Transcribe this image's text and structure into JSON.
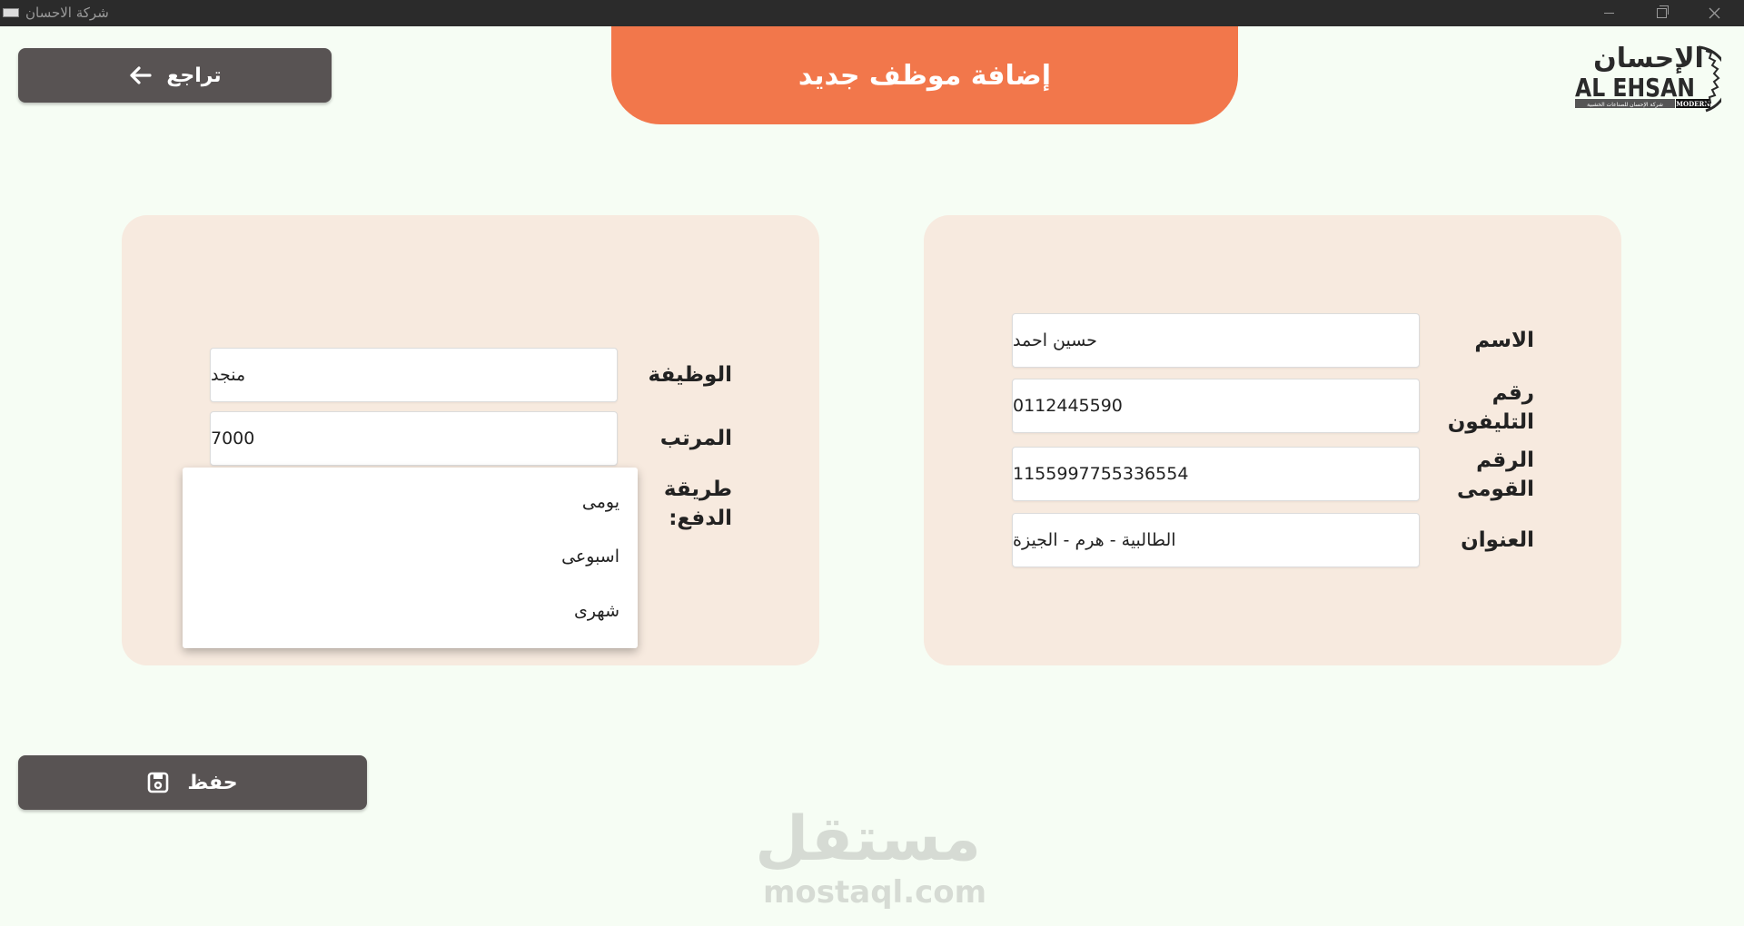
{
  "window": {
    "title": "شركة الاحسان"
  },
  "header": {
    "title": "إضافة موظف جديد",
    "back_label": "تراجع"
  },
  "logo": {
    "arabic": "الإحسان",
    "latin": "AL EHSAN",
    "tagline": "شركة الإحسان للصناعات الخشبية",
    "badge": "MODERN"
  },
  "personal_card": {
    "fields": [
      {
        "label": "الاسم",
        "value": "حسين احمد"
      },
      {
        "label": "رقم التليفون",
        "value": "0112445590"
      },
      {
        "label": "الرقم القومى",
        "value": "1155997755336554"
      },
      {
        "label": "العنوان",
        "value": "الطالبية - هرم - الجيزة"
      }
    ]
  },
  "job_card": {
    "job_label": "الوظيفة",
    "job_value": "منجد",
    "salary_label": "المرتب",
    "salary_value": "7000",
    "payment_label": "طريقة الدفع:",
    "payment_options": [
      "يومى",
      "اسبوعى",
      "شهرى"
    ]
  },
  "actions": {
    "save_label": "حفظ"
  },
  "watermark": {
    "arabic": "مستقل",
    "latin": "mostaql.com"
  },
  "colors": {
    "background": "#f6fdf4",
    "accent": "#f2774b",
    "button": "#585353",
    "card": "#f7eadf"
  }
}
